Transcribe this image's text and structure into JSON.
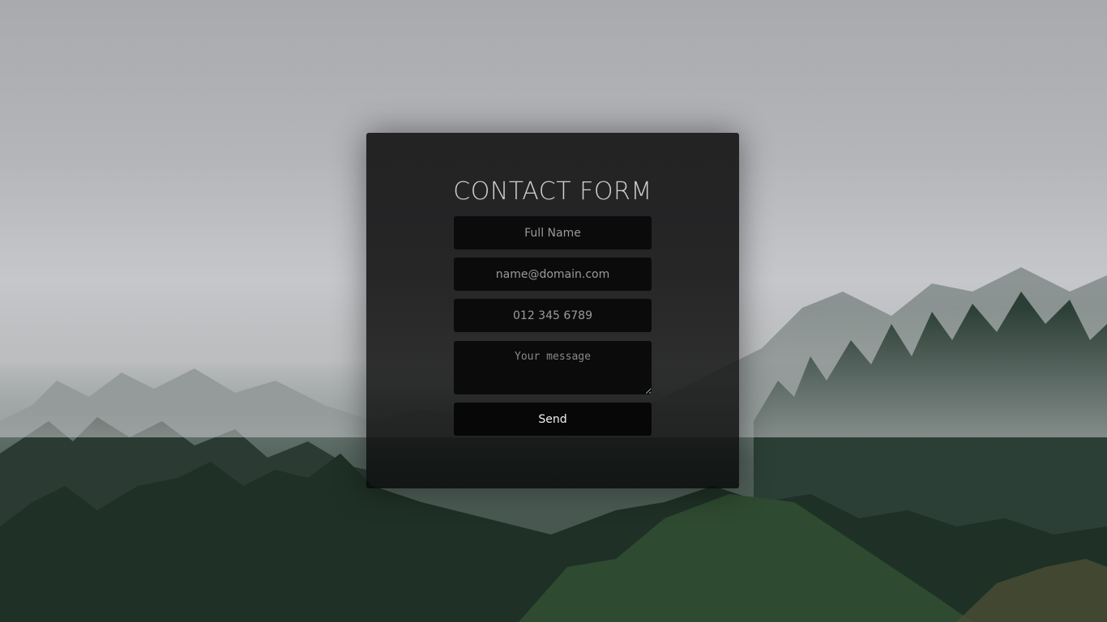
{
  "contact_form": {
    "title": "CONTACT FORM",
    "full_name": {
      "placeholder": "Full Name",
      "value": ""
    },
    "email": {
      "placeholder": "name@domain.com",
      "value": ""
    },
    "phone": {
      "placeholder": "012 345 6789",
      "value": ""
    },
    "message": {
      "placeholder": "Your message",
      "value": ""
    },
    "send_label": "Send"
  },
  "colors": {
    "panel": "#1f1f20",
    "field": "#0b0b0b",
    "button": "#070707",
    "title_text": "#cfcfcf",
    "fog": "#c6c7cb",
    "forest": "#26382d"
  }
}
